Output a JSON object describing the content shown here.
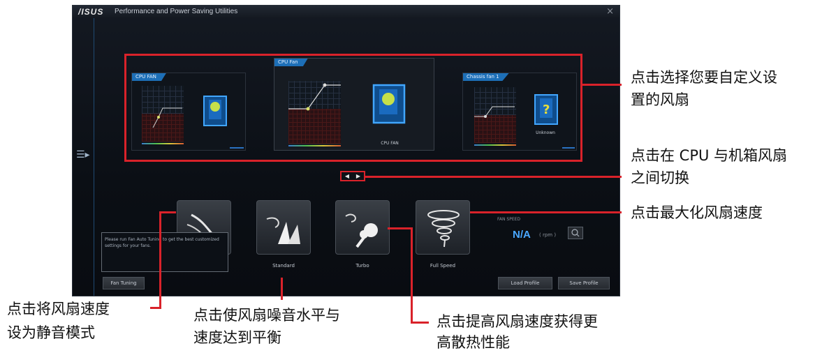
{
  "window": {
    "logo": "/ISUS",
    "title": "Performance and Power Saving Utilities",
    "close": "×"
  },
  "menu_icon_glyph": "☰▸",
  "fans": [
    {
      "name": "CPU Fan",
      "label": "CPU FAN",
      "active": true
    },
    {
      "name": "Chassis fan 1",
      "label": "Unknown",
      "active": false
    },
    {
      "name": "CPU FAN",
      "label": "",
      "active": false
    }
  ],
  "nav": {
    "prev": "◀",
    "next": "▶"
  },
  "modes": [
    {
      "label": "",
      "id": "silent"
    },
    {
      "label": "Standard",
      "id": "standard"
    },
    {
      "label": "Turbo",
      "id": "turbo"
    },
    {
      "label": "Full Speed",
      "id": "full-speed"
    }
  ],
  "tooltip": "Please run Fan Auto Tuning to get the best customized settings for your fans.",
  "buttons": {
    "fan_tuning": "Fan Tuning",
    "load_profile": "Load Profile",
    "save_profile": "Save Profile"
  },
  "fan_speed": {
    "label": "FAN SPEED",
    "value": "N/A",
    "unit": "( rpm )"
  },
  "annotations": {
    "select_fan_1": "点击选择您要自定义设",
    "select_fan_2": "置的风扇",
    "switch_1": "点击在 CPU 与机箱风扇",
    "switch_2": "之间切换",
    "max_speed": "点击最大化风扇速度",
    "silent_1": "点击将风扇速度",
    "silent_2": "设为静音模式",
    "balance_1": "点击使风扇噪音水平与",
    "balance_2": "速度达到平衡",
    "turbo_1": "点击提高风扇速度获得更",
    "turbo_2": "高散热性能"
  },
  "colors": {
    "highlight": "#d9222a",
    "accent_blue": "#1d6fb7",
    "na_blue": "#4aa8ff"
  }
}
